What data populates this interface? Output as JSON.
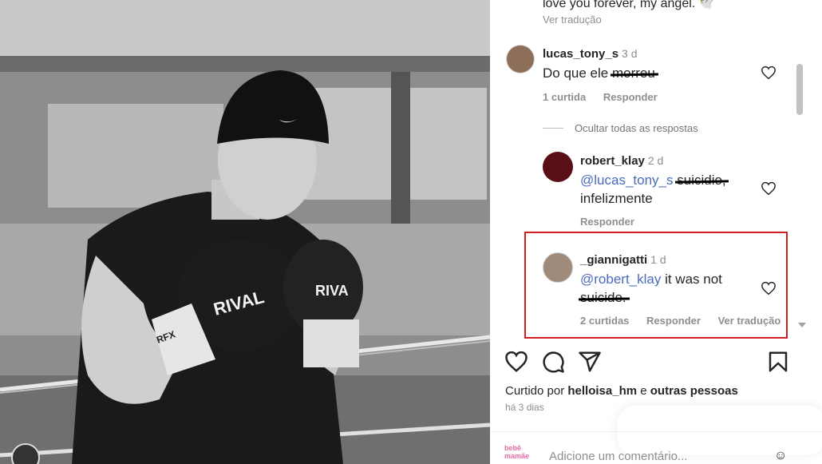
{
  "post": {
    "image_alt": "Black and white photo of a young boxer in a guard stance wearing RIVAL gloves and a Nike cap",
    "glove_brand": "RIVAL",
    "glove_brand_right": "RIVA",
    "glove_brand_small": "RFX"
  },
  "top_comment": {
    "text": "love you forever, my angel. 🕊️",
    "translate": "Ver tradução"
  },
  "comments": [
    {
      "username": "lucas_tony_s",
      "time": "3 d",
      "text_before": "Do que ele ",
      "struck": "morreu",
      "likes": "1 curtida",
      "reply": "Responder"
    }
  ],
  "hide_replies": "Ocultar todas as respostas",
  "replies": [
    {
      "username": "robert_klay",
      "time": "2 d",
      "mention": "@lucas_tony_s",
      "struck": "suicidio,",
      "text_line2": "infelizmente",
      "reply": "Responder"
    },
    {
      "username": "_giannigatti",
      "time": "1 d",
      "mention": "@robert_klay",
      "text": " it was not",
      "struck": "suicide.",
      "likes": "2 curtidas",
      "reply": "Responder",
      "translate": "Ver tradução"
    }
  ],
  "footer": {
    "liked_prefix": "Curtido por",
    "liked_user": "helloisa_hm",
    "liked_and": "e",
    "liked_others": "outras pessoas",
    "date": "há 3 dias",
    "add_comment_placeholder": "Adicione um comentário...",
    "logo_text_1": "bebê",
    "logo_text_2": "mamãe"
  },
  "colors": {
    "highlight": "#d01f25",
    "mention": "#4a6bbd"
  }
}
